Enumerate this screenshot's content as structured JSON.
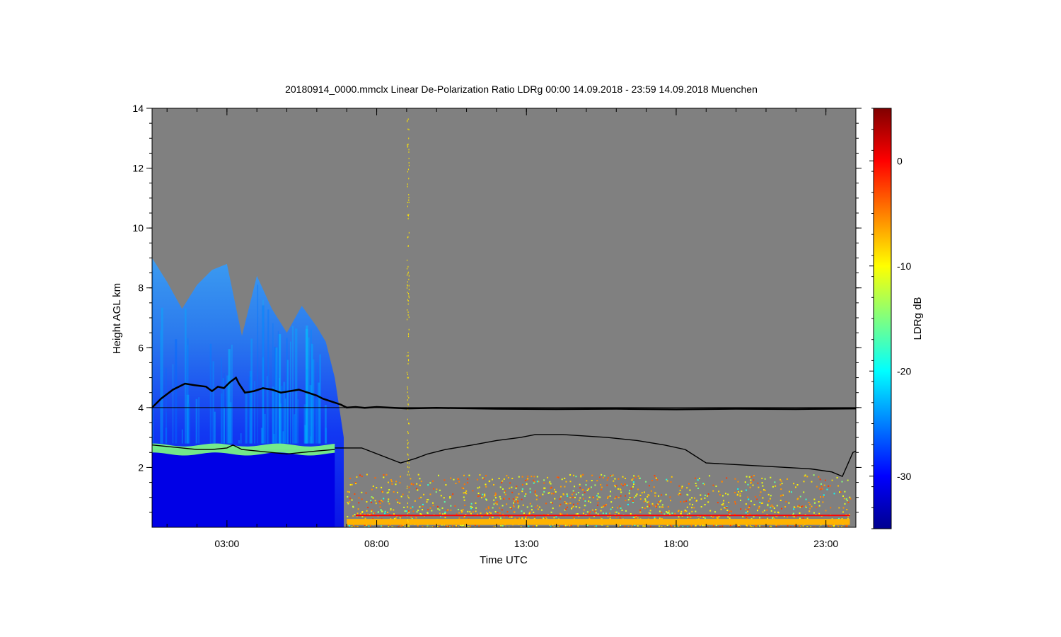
{
  "chart_data": {
    "type": "heatmap",
    "title": "20180914_0000.mmclx Linear De-Polarization Ratio LDRg   00:00 14.09.2018 - 23:59 14.09.2018 Muenchen",
    "xlabel": "Time UTC",
    "ylabel": "Height AGL km",
    "colorbar_label": "LDRg dB",
    "xlim": [
      0.5,
      24.0
    ],
    "ylim": [
      0.0,
      14.0
    ],
    "x_ticks": [
      {
        "value": 3,
        "label": "03:00"
      },
      {
        "value": 8,
        "label": "08:00"
      },
      {
        "value": 13,
        "label": "13:00"
      },
      {
        "value": 18,
        "label": "18:00"
      },
      {
        "value": 23,
        "label": "23:00"
      }
    ],
    "y_ticks": [
      {
        "value": 2,
        "label": "2"
      },
      {
        "value": 4,
        "label": "4"
      },
      {
        "value": 6,
        "label": "6"
      },
      {
        "value": 8,
        "label": "8"
      },
      {
        "value": 10,
        "label": "10"
      },
      {
        "value": 12,
        "label": "12"
      },
      {
        "value": 14,
        "label": "14"
      }
    ],
    "colorbar_range": [
      -35,
      5
    ],
    "colorbar_ticks": [
      {
        "value": 0,
        "label": "0"
      },
      {
        "value": -10,
        "label": "-10"
      },
      {
        "value": -20,
        "label": "-20"
      },
      {
        "value": -30,
        "label": "-30"
      }
    ],
    "reference_line_km": 4.0,
    "background_color": "#808080",
    "cloud_region": {
      "x": [
        0.5,
        1.0,
        1.5,
        2.0,
        2.5,
        3.0,
        3.5,
        4.0,
        4.5,
        5.0,
        5.5,
        6.0,
        6.3,
        6.6,
        6.9
      ],
      "top_km": [
        9.0,
        8.2,
        7.3,
        8.1,
        8.6,
        8.8,
        6.4,
        8.4,
        7.3,
        6.5,
        7.4,
        6.7,
        6.2,
        5.0,
        3.0
      ],
      "bright_band_km": 2.6,
      "ldr_core_db": -31,
      "ldr_upper_db": -26,
      "ldr_band_db": -15
    },
    "clutter_region": {
      "x_start": 7.0,
      "x_end": 23.8,
      "top_km": 1.8,
      "ldr_range_db": [
        -12,
        -2
      ],
      "dense_span": [
        11.5,
        17.5
      ]
    },
    "series": [
      {
        "x": [
          0.5,
          0.8,
          1.2,
          1.6,
          1.9,
          2.3,
          2.5,
          2.7,
          2.9,
          3.1,
          3.3,
          3.4,
          3.6,
          3.9,
          4.2,
          4.5,
          4.8,
          5.1,
          5.4,
          5.7,
          6.0,
          6.2,
          6.5,
          6.8,
          7.0,
          7.3,
          7.6,
          8.0,
          9.0,
          10.0,
          12.0,
          14.0,
          16.0,
          18.0,
          20.0,
          22.0,
          24.0
        ],
        "y": [
          4.0,
          4.3,
          4.6,
          4.8,
          4.75,
          4.7,
          4.55,
          4.7,
          4.65,
          4.85,
          5.0,
          4.8,
          4.5,
          4.55,
          4.65,
          4.6,
          4.5,
          4.55,
          4.6,
          4.5,
          4.4,
          4.3,
          4.2,
          4.1,
          4.0,
          4.02,
          3.99,
          4.02,
          3.97,
          3.99,
          3.96,
          3.95,
          3.96,
          3.94,
          3.96,
          3.95,
          3.97
        ]
      },
      {
        "x": [
          0.5,
          1.0,
          1.5,
          2.0,
          2.5,
          3.0,
          3.2,
          3.5,
          4.0,
          4.5,
          5.0,
          5.5,
          6.0,
          6.6
        ],
        "y": [
          2.75,
          2.7,
          2.65,
          2.6,
          2.6,
          2.65,
          2.75,
          2.6,
          2.55,
          2.5,
          2.45,
          2.5,
          2.55,
          2.6
        ]
      },
      {
        "x": [
          6.6,
          7.5,
          8.8,
          9.3,
          9.7,
          10.3,
          11.2,
          12.0,
          12.8,
          13.3,
          14.2,
          15.7,
          16.7,
          17.6,
          18.3,
          19.0,
          20.8,
          22.5,
          23.2,
          23.55,
          23.9,
          24.0
        ],
        "y": [
          2.65,
          2.65,
          2.15,
          2.3,
          2.45,
          2.6,
          2.75,
          2.9,
          3.0,
          3.1,
          3.1,
          3.0,
          2.9,
          2.75,
          2.6,
          2.15,
          2.05,
          1.95,
          1.85,
          1.7,
          2.5,
          2.55
        ]
      }
    ]
  }
}
